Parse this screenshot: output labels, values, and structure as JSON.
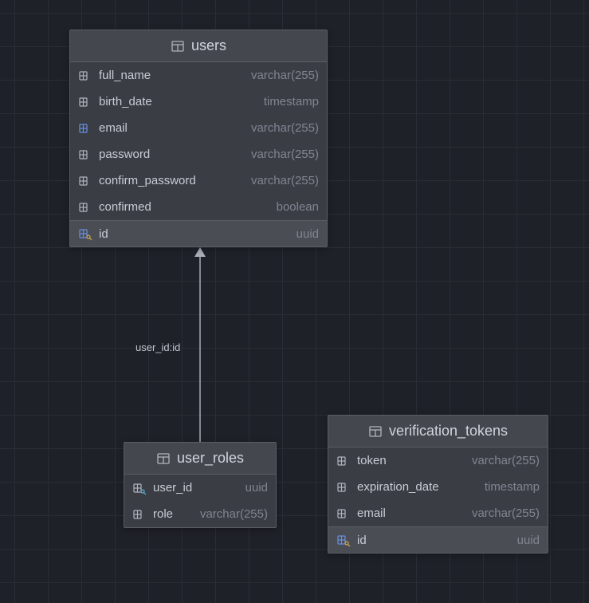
{
  "tables": {
    "users": {
      "title": "users",
      "columns": [
        {
          "name": "full_name",
          "type": "varchar(255)",
          "icon": "col"
        },
        {
          "name": "birth_date",
          "type": "timestamp",
          "icon": "col"
        },
        {
          "name": "email",
          "type": "varchar(255)",
          "icon": "col-idx"
        },
        {
          "name": "password",
          "type": "varchar(255)",
          "icon": "col"
        },
        {
          "name": "confirm_password",
          "type": "varchar(255)",
          "icon": "col"
        },
        {
          "name": "confirmed",
          "type": "boolean",
          "icon": "col"
        },
        {
          "name": "id",
          "type": "uuid",
          "icon": "pk",
          "selected": true
        }
      ]
    },
    "user_roles": {
      "title": "user_roles",
      "columns": [
        {
          "name": "user_id",
          "type": "uuid",
          "icon": "fk"
        },
        {
          "name": "role",
          "type": "varchar(255)",
          "icon": "col"
        }
      ]
    },
    "verification_tokens": {
      "title": "verification_tokens",
      "columns": [
        {
          "name": "token",
          "type": "varchar(255)",
          "icon": "col"
        },
        {
          "name": "expiration_date",
          "type": "timestamp",
          "icon": "col"
        },
        {
          "name": "email",
          "type": "varchar(255)",
          "icon": "col"
        },
        {
          "name": "id",
          "type": "uuid",
          "icon": "pk",
          "selected": true
        }
      ]
    }
  },
  "relationship": {
    "label": "user_id:id"
  }
}
